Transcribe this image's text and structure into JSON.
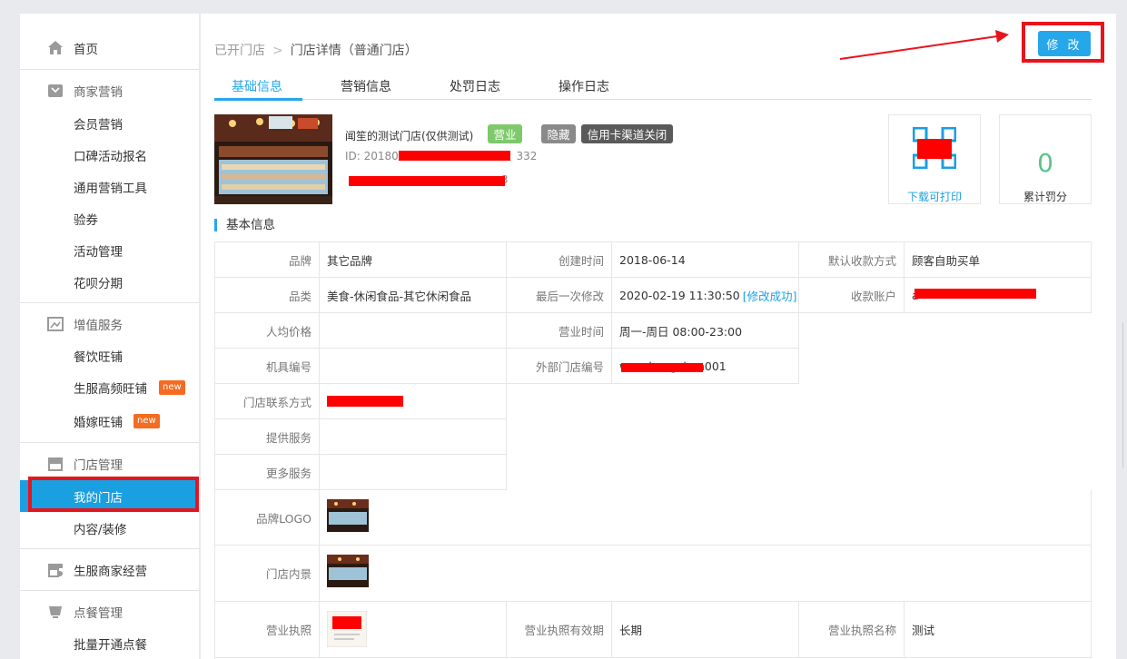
{
  "sidebar": {
    "home": "首页",
    "marketing": {
      "title": "商家营销",
      "items": [
        "会员营销",
        "口碑活动报名",
        "通用营销工具",
        "验券",
        "活动管理",
        "花呗分期"
      ]
    },
    "value_added": {
      "title": "增值服务",
      "items": [
        "餐饮旺铺",
        "生服高频旺铺",
        "婚嫁旺铺"
      ],
      "new_badge": "new"
    },
    "store_mgmt": {
      "title": "门店管理",
      "items": [
        "我的门店",
        "内容/装修"
      ]
    },
    "life_service": {
      "title": "生服商家经营"
    },
    "ordering": {
      "title": "点餐管理",
      "items": [
        "批量开通点餐"
      ]
    }
  },
  "breadcrumb": {
    "parent": "已开门店",
    "separator": ">",
    "current": "门店详情（普通门店）"
  },
  "edit_button": "修 改",
  "tabs": [
    "基础信息",
    "营销信息",
    "处罚日志",
    "操作日志"
  ],
  "store": {
    "name": "闻笙的测试门店(仅供测试)",
    "status_tag": "营业",
    "hidden_tag": "隐藏",
    "credit_tag": "信用卡渠道关闭",
    "id_prefix": "ID: 201806",
    "id_suffix": "332",
    "addr_suffix": "3"
  },
  "qr": {
    "label": "下载可打印"
  },
  "penalty": {
    "value": "0",
    "label": "累计罚分"
  },
  "section_title": "基本信息",
  "info": {
    "brand_k": "品牌",
    "brand_v": "其它品牌",
    "created_k": "创建时间",
    "created_v": "2018-06-14",
    "pay_k": "默认收款方式",
    "pay_v": "顾客自助买单",
    "cat_k": "品类",
    "cat_v": "美食-休闲食品-其它休闲食品",
    "modified_k": "最后一次修改",
    "modified_v": "2020-02-19 11:30:50",
    "modified_status": "[修改成功]",
    "account_k": "收款账户",
    "account_v": "a",
    "avg_k": "人均价格",
    "avg_v": "",
    "hours_k": "营业时间",
    "hours_v": "周一-周日 08:00-23:00",
    "machine_k": "机具编号",
    "machine_v": "",
    "ext_k": "外部门店编号",
    "ext_v": "wenshengshen001",
    "contact_k": "门店联系方式",
    "services_k": "提供服务",
    "more_k": "更多服务",
    "logo_k": "品牌LOGO",
    "interior_k": "门店内景",
    "license_k": "营业执照",
    "license_valid_k": "营业执照有效期",
    "license_valid_v": "长期",
    "license_name_k": "营业执照名称",
    "license_name_v": "测试"
  },
  "colors": {
    "accent": "#26a7ea",
    "annotation_red": "#e8141c",
    "status_green": "#7dc96b",
    "tag_gray": "#8a8a8a",
    "tag_dark": "#5a5a5a"
  }
}
